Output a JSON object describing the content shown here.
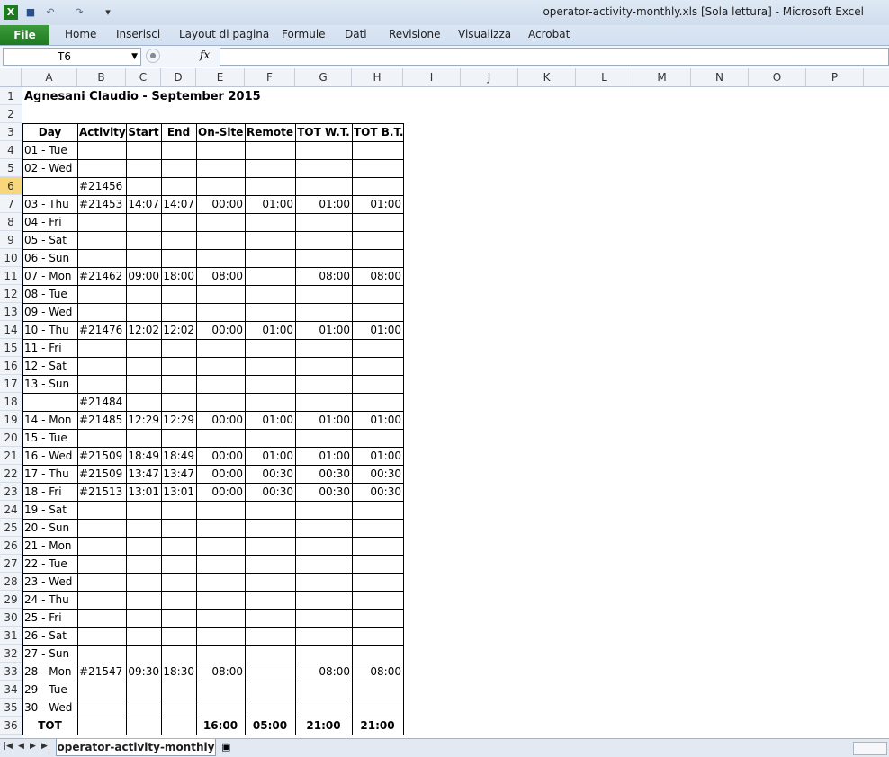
{
  "window": {
    "title": "operator-activity-monthly.xls  [Sola lettura]  -  Microsoft Excel",
    "excel_icon": "excel-icon",
    "qa_icons": [
      "save-icon",
      "undo-icon",
      "redo-icon",
      "customize-icon"
    ],
    "accent": "#1e7a1e"
  },
  "ribbon": {
    "file_label": "File",
    "tabs": [
      "Home",
      "Inserisci",
      "Layout di pagina",
      "Formule",
      "Dati",
      "Revisione",
      "Visualizza",
      "Acrobat"
    ]
  },
  "formula_bar": {
    "name_box": "T6",
    "fx": "fx",
    "value": ""
  },
  "columns": [
    "A",
    "B",
    "C",
    "D",
    "E",
    "F",
    "G",
    "H",
    "I",
    "J",
    "K",
    "L",
    "M",
    "N",
    "O",
    "P"
  ],
  "rows": [
    "1",
    "2",
    "3",
    "4",
    "5",
    "6",
    "7",
    "8",
    "9",
    "10",
    "11",
    "12",
    "13",
    "14",
    "15",
    "16",
    "17",
    "18",
    "19",
    "20",
    "21",
    "22",
    "23",
    "24",
    "25",
    "26",
    "27",
    "28",
    "29",
    "30",
    "31",
    "32",
    "33",
    "34",
    "35",
    "36"
  ],
  "selected_row": "6",
  "sheet": {
    "title": "Agnesani Claudio - September 2015",
    "headers": [
      "Day",
      "Activity",
      "Start",
      "End",
      "On-Site",
      "Remote",
      "TOT W.T.",
      "TOT B.T."
    ],
    "data": [
      [
        "01 - Tue",
        "",
        "",
        "",
        "",
        "",
        "",
        ""
      ],
      [
        "02 - Wed",
        "",
        "",
        "",
        "",
        "",
        "",
        ""
      ],
      [
        "",
        "#21456",
        "",
        "",
        "",
        "",
        "",
        ""
      ],
      [
        "03 - Thu",
        "#21453",
        "14:07",
        "14:07",
        "00:00",
        "01:00",
        "01:00",
        "01:00"
      ],
      [
        "04 - Fri",
        "",
        "",
        "",
        "",
        "",
        "",
        ""
      ],
      [
        "05 - Sat",
        "",
        "",
        "",
        "",
        "",
        "",
        ""
      ],
      [
        "06 - Sun",
        "",
        "",
        "",
        "",
        "",
        "",
        ""
      ],
      [
        "07 - Mon",
        "#21462",
        "09:00",
        "18:00",
        "08:00",
        "",
        "08:00",
        "08:00"
      ],
      [
        "08 - Tue",
        "",
        "",
        "",
        "",
        "",
        "",
        ""
      ],
      [
        "09 - Wed",
        "",
        "",
        "",
        "",
        "",
        "",
        ""
      ],
      [
        "10 - Thu",
        "#21476",
        "12:02",
        "12:02",
        "00:00",
        "01:00",
        "01:00",
        "01:00"
      ],
      [
        "11 - Fri",
        "",
        "",
        "",
        "",
        "",
        "",
        ""
      ],
      [
        "12 - Sat",
        "",
        "",
        "",
        "",
        "",
        "",
        ""
      ],
      [
        "13 - Sun",
        "",
        "",
        "",
        "",
        "",
        "",
        ""
      ],
      [
        "",
        "#21484",
        "",
        "",
        "",
        "",
        "",
        ""
      ],
      [
        "14 - Mon",
        "#21485",
        "12:29",
        "12:29",
        "00:00",
        "01:00",
        "01:00",
        "01:00"
      ],
      [
        "15 - Tue",
        "",
        "",
        "",
        "",
        "",
        "",
        ""
      ],
      [
        "16 - Wed",
        "#21509",
        "18:49",
        "18:49",
        "00:00",
        "01:00",
        "01:00",
        "01:00"
      ],
      [
        "17 - Thu",
        "#21509",
        "13:47",
        "13:47",
        "00:00",
        "00:30",
        "00:30",
        "00:30"
      ],
      [
        "18 - Fri",
        "#21513",
        "13:01",
        "13:01",
        "00:00",
        "00:30",
        "00:30",
        "00:30"
      ],
      [
        "19 - Sat",
        "",
        "",
        "",
        "",
        "",
        "",
        ""
      ],
      [
        "20 - Sun",
        "",
        "",
        "",
        "",
        "",
        "",
        ""
      ],
      [
        "21 - Mon",
        "",
        "",
        "",
        "",
        "",
        "",
        ""
      ],
      [
        "22 - Tue",
        "",
        "",
        "",
        "",
        "",
        "",
        ""
      ],
      [
        "23 - Wed",
        "",
        "",
        "",
        "",
        "",
        "",
        ""
      ],
      [
        "24 - Thu",
        "",
        "",
        "",
        "",
        "",
        "",
        ""
      ],
      [
        "25 - Fri",
        "",
        "",
        "",
        "",
        "",
        "",
        ""
      ],
      [
        "26 - Sat",
        "",
        "",
        "",
        "",
        "",
        "",
        ""
      ],
      [
        "27 - Sun",
        "",
        "",
        "",
        "",
        "",
        "",
        ""
      ],
      [
        "28 - Mon",
        "#21547",
        "09:30",
        "18:30",
        "08:00",
        "",
        "08:00",
        "08:00"
      ],
      [
        "29 - Tue",
        "",
        "",
        "",
        "",
        "",
        "",
        ""
      ],
      [
        "30 - Wed",
        "",
        "",
        "",
        "",
        "",
        "",
        ""
      ]
    ],
    "total": [
      "TOT",
      "",
      "",
      "",
      "16:00",
      "05:00",
      "21:00",
      "21:00"
    ]
  },
  "sheet_tabs": {
    "active": "operator-activity-monthly",
    "nav_icons": [
      "first-sheet-icon",
      "prev-sheet-icon",
      "next-sheet-icon",
      "last-sheet-icon"
    ],
    "new_sheet_icon": "new-sheet-icon"
  }
}
